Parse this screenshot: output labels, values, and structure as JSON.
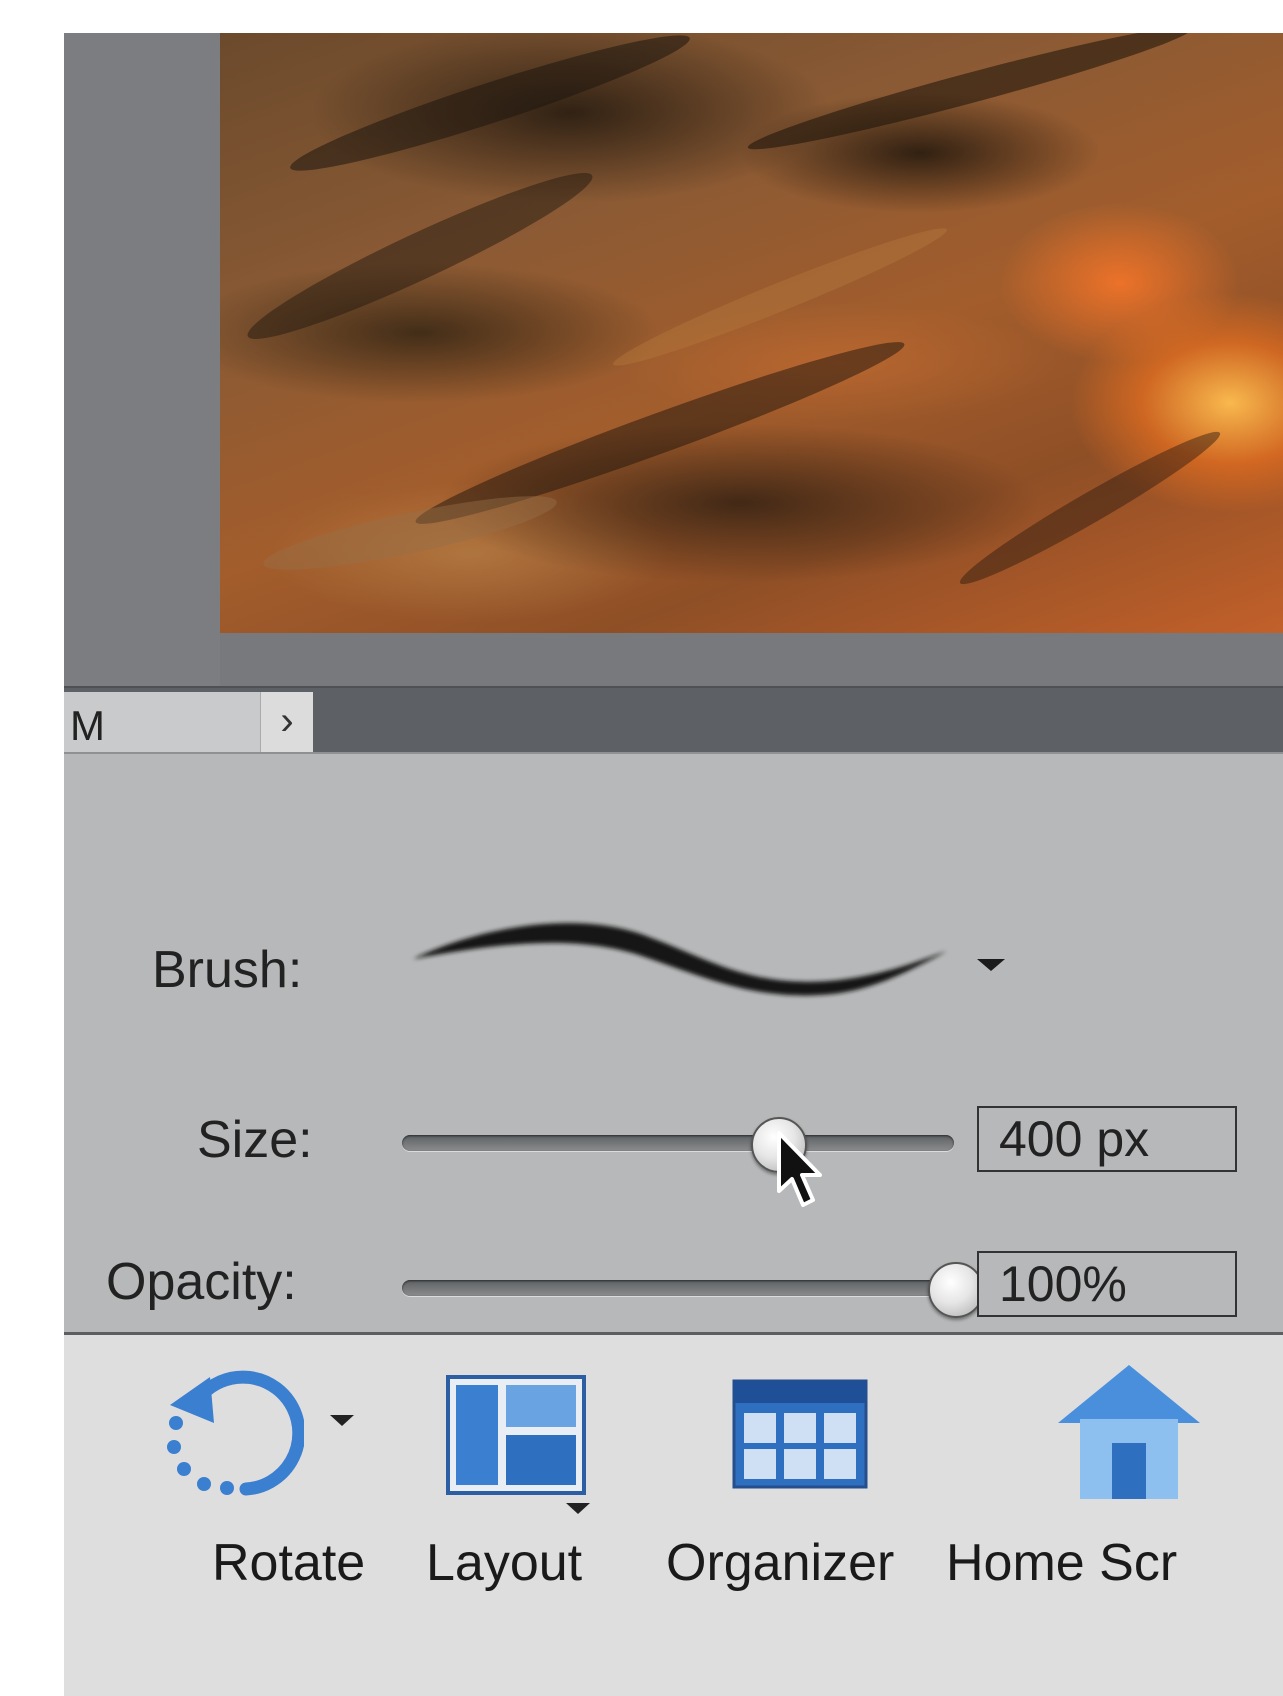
{
  "tabs": {
    "active_label": "M",
    "more_symbol": "›"
  },
  "tool_options": {
    "brush_label": "Brush:",
    "size_label": "Size:",
    "size_value": "400 px",
    "size_fraction": 0.68,
    "opacity_label": "Opacity:",
    "opacity_value": "100%",
    "opacity_fraction": 1.0
  },
  "taskbar": {
    "rotate_label": "Rotate",
    "layout_label": "Layout",
    "organizer_label": "Organizer",
    "home_label": "Home Scr"
  },
  "colors": {
    "accent_blue": "#3b7fd0",
    "panel_gray": "#b7b8b9",
    "taskbar_gray": "#dededf"
  },
  "icons": [
    "rotate-icon",
    "layout-icon",
    "organizer-icon",
    "home-icon",
    "cursor-icon",
    "brush-stroke-icon"
  ]
}
